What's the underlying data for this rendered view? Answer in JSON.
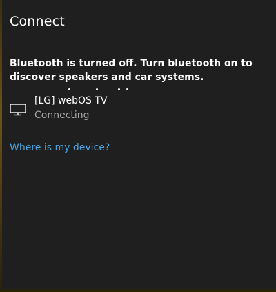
{
  "panel": {
    "title": "Connect",
    "message": "Bluetooth is turned off. Turn bluetooth on to discover speakers and car systems.",
    "searching_indicator": "progress-dots",
    "device": {
      "icon": "monitor-icon",
      "name": "[LG] webOS TV",
      "status": "Connecting"
    },
    "help_link": "Where is my device?"
  },
  "colors": {
    "panel_background": "#1f1f1f",
    "text_primary": "#ffffff",
    "text_secondary": "#a6a6a6",
    "link": "#4aa3df"
  }
}
